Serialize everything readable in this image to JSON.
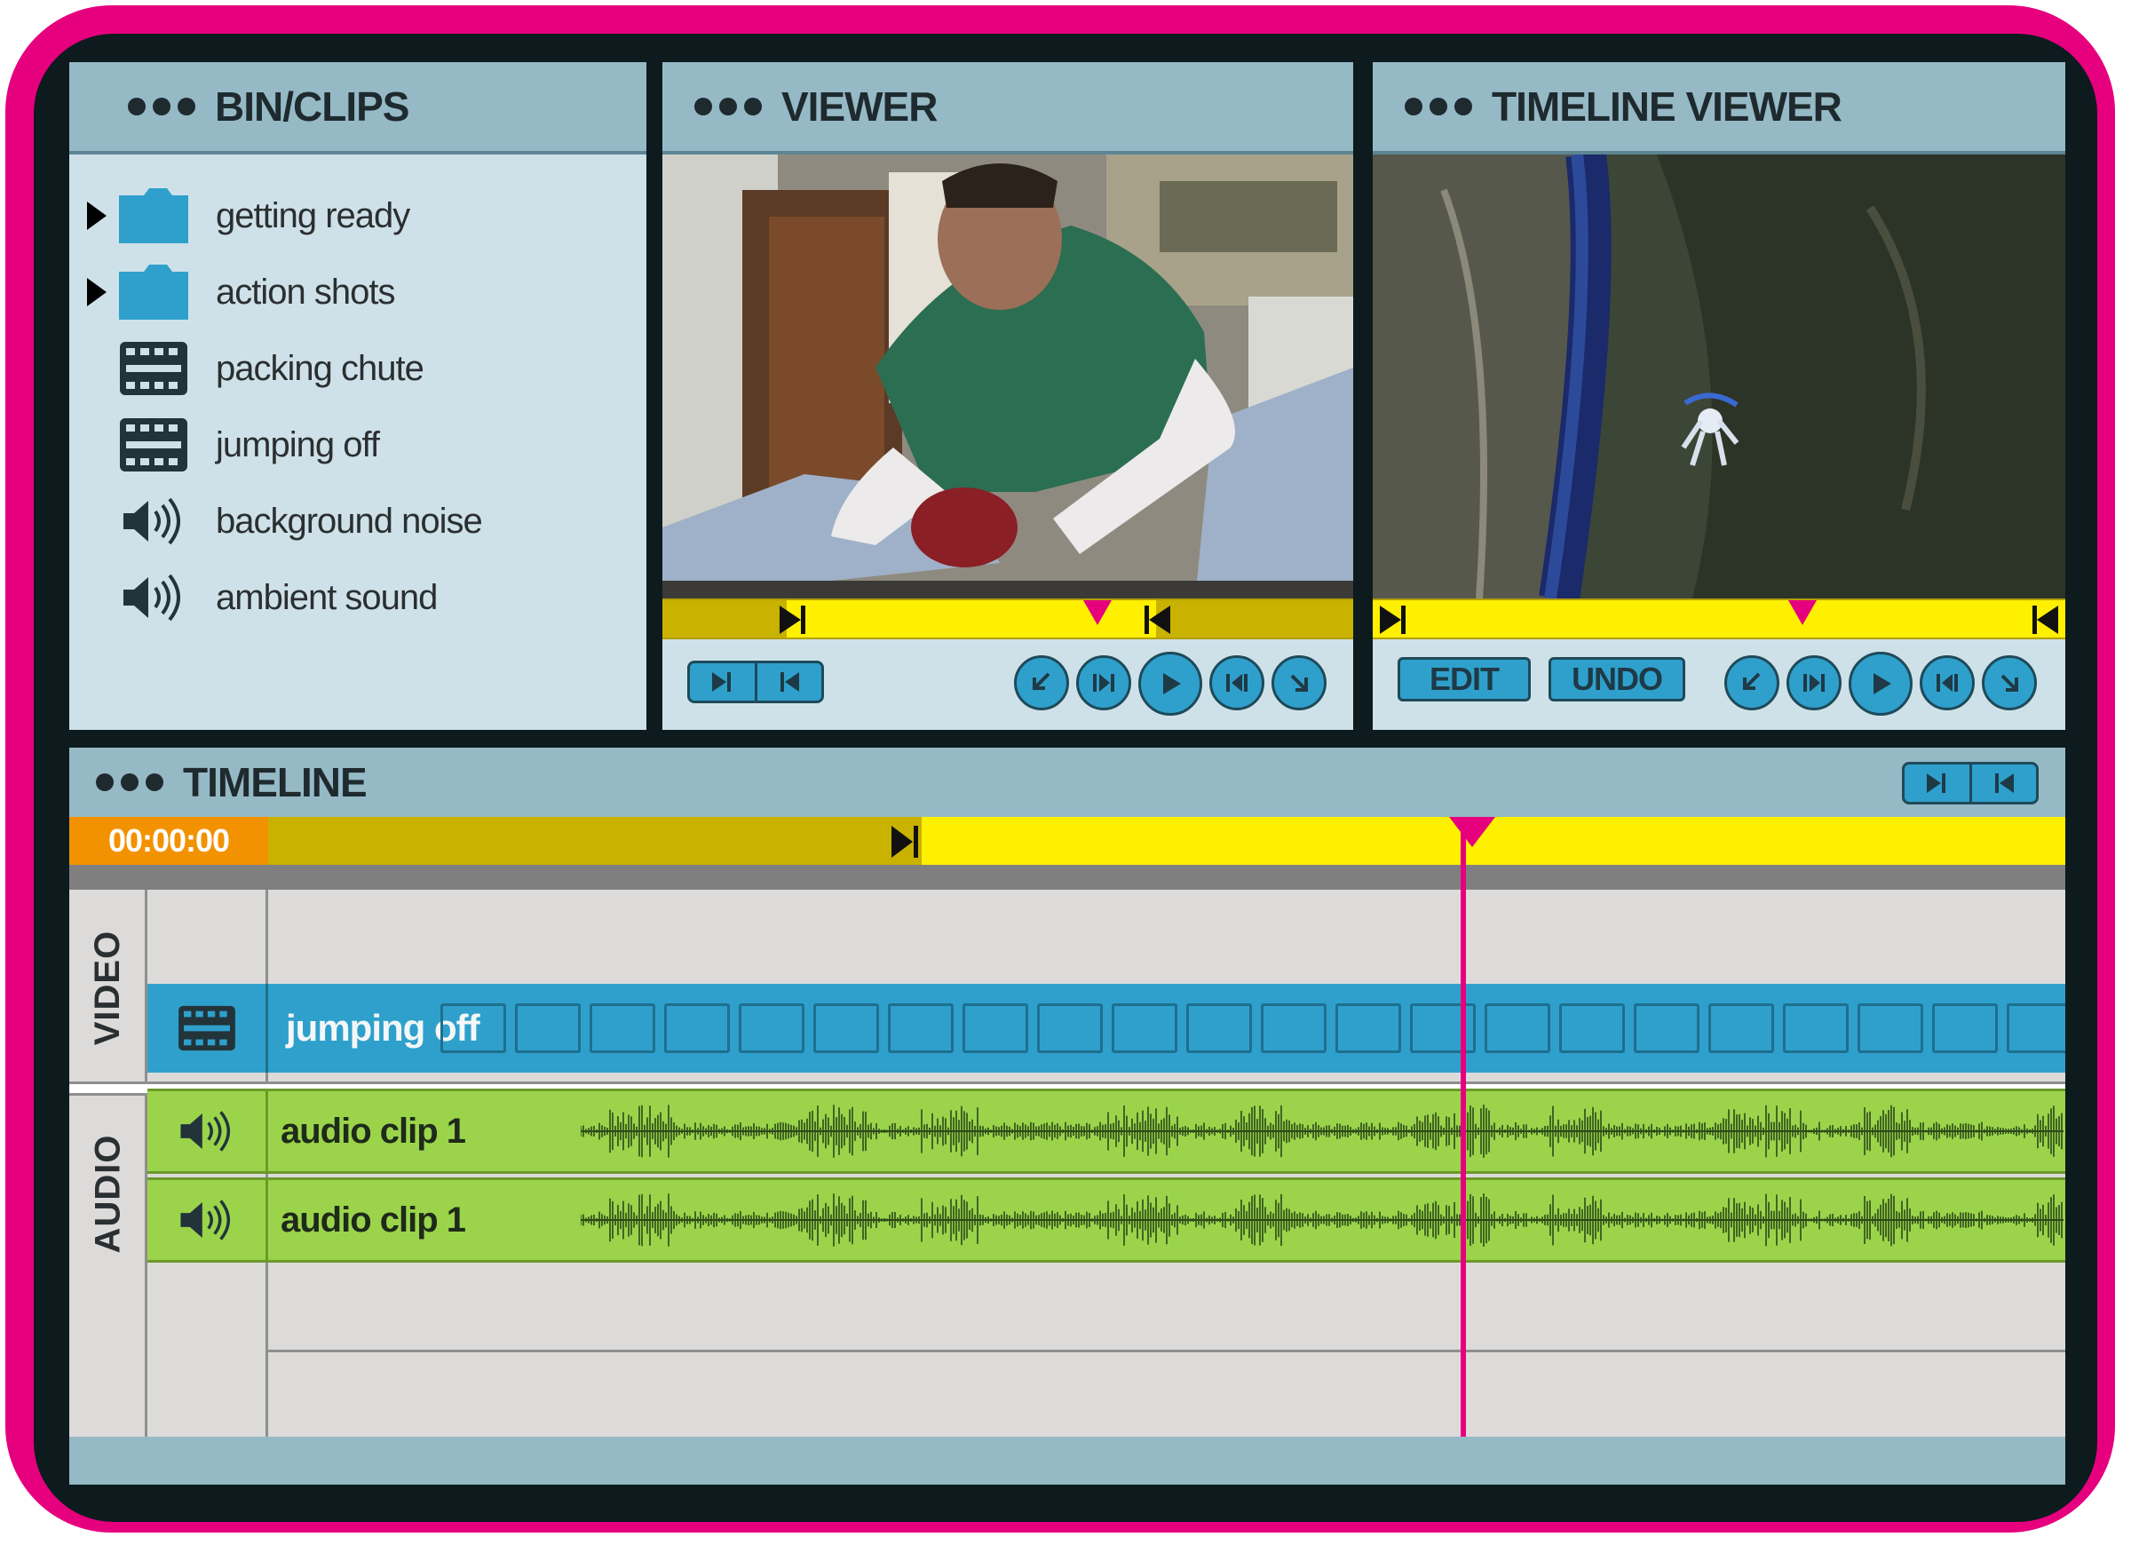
{
  "bin": {
    "title": "BIN/CLIPS",
    "items": [
      {
        "label": "getting ready",
        "icon": "folder-icon",
        "expandable": true
      },
      {
        "label": "action shots",
        "icon": "folder-icon",
        "expandable": true
      },
      {
        "label": "packing chute",
        "icon": "film-clip-icon",
        "expandable": false
      },
      {
        "label": "jumping off",
        "icon": "film-clip-icon",
        "expandable": false
      },
      {
        "label": "background noise",
        "icon": "speaker-icon",
        "expandable": false
      },
      {
        "label": "ambient sound",
        "icon": "speaker-icon",
        "expandable": false
      }
    ]
  },
  "viewer": {
    "title": "VIEWER",
    "playhead_fraction": 0.63
  },
  "timeline_viewer": {
    "title": "TIMELINE VIEWER",
    "edit_label": "EDIT",
    "undo_label": "UNDO",
    "playhead_fraction": 0.62
  },
  "timeline": {
    "title": "TIMELINE",
    "timecode": "00:00:00",
    "video_label": "VIDEO",
    "audio_label": "AUDIO",
    "video_clip": "jumping off",
    "audio_clips": [
      "audio clip 1",
      "audio clip 1"
    ]
  },
  "colors": {
    "frame": "#e6007e",
    "panel_header": "#96b9c6",
    "panel_body": "#cfe1e8",
    "accent_blue": "#2fa0cc",
    "scrub_yellow": "#fff000",
    "scrub_dark": "#c9b200",
    "timecode_orange": "#f39200",
    "playhead_magenta": "#e6007e",
    "audio_green": "#9bd44b"
  }
}
